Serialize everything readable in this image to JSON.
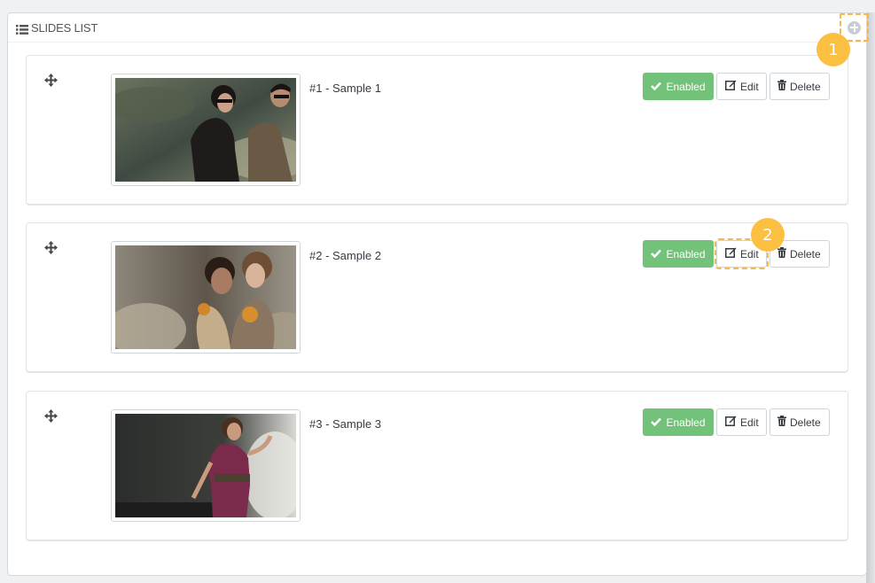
{
  "panel": {
    "title": "Slides list",
    "list_icon": "list-icon",
    "add_icon": "add-circle-icon"
  },
  "annotations": {
    "badge_1": "1",
    "badge_2": "2"
  },
  "slides": [
    {
      "title": "#1 - Sample 1",
      "status_label": "Enabled",
      "edit_label": "Edit",
      "delete_label": "Delete",
      "image": "two-people-sunglasses-photo"
    },
    {
      "title": "#2 - Sample 2",
      "status_label": "Enabled",
      "edit_label": "Edit",
      "delete_label": "Delete",
      "image": "two-women-scarves-photo"
    },
    {
      "title": "#3 - Sample 3",
      "status_label": "Enabled",
      "edit_label": "Edit",
      "delete_label": "Delete",
      "image": "woman-purple-dress-photo"
    }
  ],
  "colors": {
    "enabled": "#72c279",
    "highlight": "#f5b754",
    "badge": "#fbbf41"
  }
}
